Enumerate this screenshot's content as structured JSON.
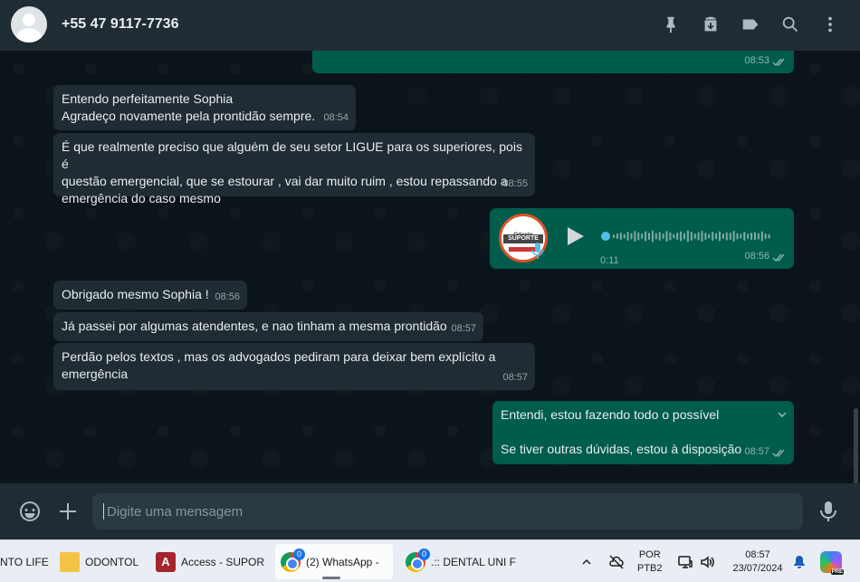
{
  "header": {
    "contact_name": "+55 47 9117-7736",
    "icons": [
      "pin-icon",
      "archive-icon",
      "label-icon",
      "search-icon",
      "menu-icon"
    ]
  },
  "messages": [
    {
      "direction": "out",
      "time": "08:53",
      "ticks": true,
      "text": ""
    },
    {
      "direction": "in",
      "lines": [
        "Entendo perfeitamente Sophia",
        "Agradeço novamente pela prontidão sempre."
      ],
      "time": "08:54"
    },
    {
      "direction": "in",
      "lines": [
        "É que realmente preciso que alguém de seu setor LIGUE para os superiores, pois é",
        "questão emergencial, que se estourar , vai dar muito ruim , estou repassando a",
        "emergência do caso mesmo"
      ],
      "time": "08:55"
    },
    {
      "direction": "out",
      "type": "audio",
      "duration": "0:11",
      "time": "08:56",
      "ticks": true,
      "thumb": {
        "line1": "Odonto",
        "line2": "SUPORTE"
      }
    },
    {
      "direction": "in",
      "lines": [
        "Obrigado mesmo Sophia !"
      ],
      "time": "08:56"
    },
    {
      "direction": "in",
      "lines": [
        "Já passei por algumas atendentes, e nao tinham a mesma prontidão"
      ],
      "time": "08:57"
    },
    {
      "direction": "in",
      "lines": [
        "Perdão pelos textos , mas os advogados pediram para deixar bem explícito a",
        "emergência"
      ],
      "time": "08:57"
    },
    {
      "direction": "out",
      "lines": [
        "Entendi, estou fazendo todo o possível",
        "",
        "Se tiver outras dúvidas, estou à disposição"
      ],
      "time": "08:57",
      "ticks": true
    }
  ],
  "composer": {
    "placeholder": "Digite uma mensagem"
  },
  "taskbar": {
    "items": [
      {
        "label": "NTO LIFE"
      },
      {
        "label": "ODONTOL"
      },
      {
        "label": "Access - SUPOR"
      },
      {
        "label": "(2) WhatsApp - ",
        "badge": "0"
      },
      {
        "label": ".:: DENTAL UNI F",
        "badge": "0"
      }
    ],
    "language": [
      "POR",
      "PTB2"
    ],
    "time": "08:57",
    "date": "23/07/2024",
    "copilot_badge": "PRE"
  },
  "colors": {
    "header_bg": "#202c33",
    "chat_bg": "#0b141a",
    "incoming_bubble": "#202c33",
    "outgoing_bubble": "#005c4b",
    "text": "#e9edef",
    "taskbar_bg": "#e9eef5"
  }
}
